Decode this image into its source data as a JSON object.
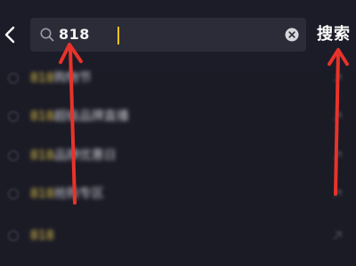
{
  "search": {
    "value": "818"
  },
  "actions": {
    "search_label": "搜索"
  },
  "suggestions": [
    {
      "highlight": "818",
      "rest": "购物节"
    },
    {
      "highlight": "818",
      "rest": "超级品牌直播"
    },
    {
      "highlight": "818",
      "rest": "品牌优惠日"
    },
    {
      "highlight": "818",
      "rest": "抢购专区"
    },
    {
      "highlight": "818",
      "rest": ""
    }
  ],
  "colors": {
    "background": "#1b1b26",
    "search_field": "#2b2c38",
    "highlight": "#e6c84a",
    "caret": "#f0c419",
    "annotation": "#e8332a"
  },
  "icons": [
    "back-chevron-icon",
    "search-icon",
    "clear-icon",
    "history-icon",
    "fill-arrow-icon"
  ]
}
